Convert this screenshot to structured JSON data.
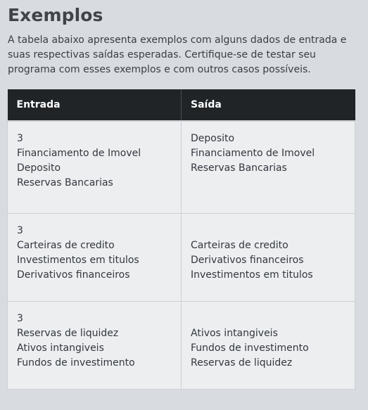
{
  "section": {
    "title": "Exemplos",
    "description": "A tabela abaixo apresenta exemplos com alguns dados de entrada e suas respectivas saídas esperadas. Certifique-se de testar seu programa com esses exemplos e com outros casos possíveis."
  },
  "table": {
    "headers": {
      "input": "Entrada",
      "output": "Saída"
    },
    "rows": [
      {
        "input": [
          "3",
          "Financiamento de Imovel",
          "Deposito",
          "Reservas Bancarias"
        ],
        "output": [
          "Deposito",
          "Financiamento de Imovel",
          "Reservas Bancarias",
          ""
        ]
      },
      {
        "input": [
          "3",
          "Carteiras de credito",
          "Investimentos em titulos",
          "Derivativos financeiros"
        ],
        "output": [
          "",
          "Carteiras de credito",
          "Derivativos financeiros",
          "Investimentos em titulos"
        ]
      },
      {
        "input": [
          "3",
          "Reservas de liquidez",
          "Ativos intangiveis",
          "Fundos de investimento"
        ],
        "output": [
          "",
          "Ativos intangiveis",
          "Fundos de investimento",
          "Reservas de liquidez"
        ]
      }
    ]
  },
  "colors": {
    "page_background": "#d8dbdf",
    "header_background": "#212427",
    "cell_background": "#eceef0"
  }
}
